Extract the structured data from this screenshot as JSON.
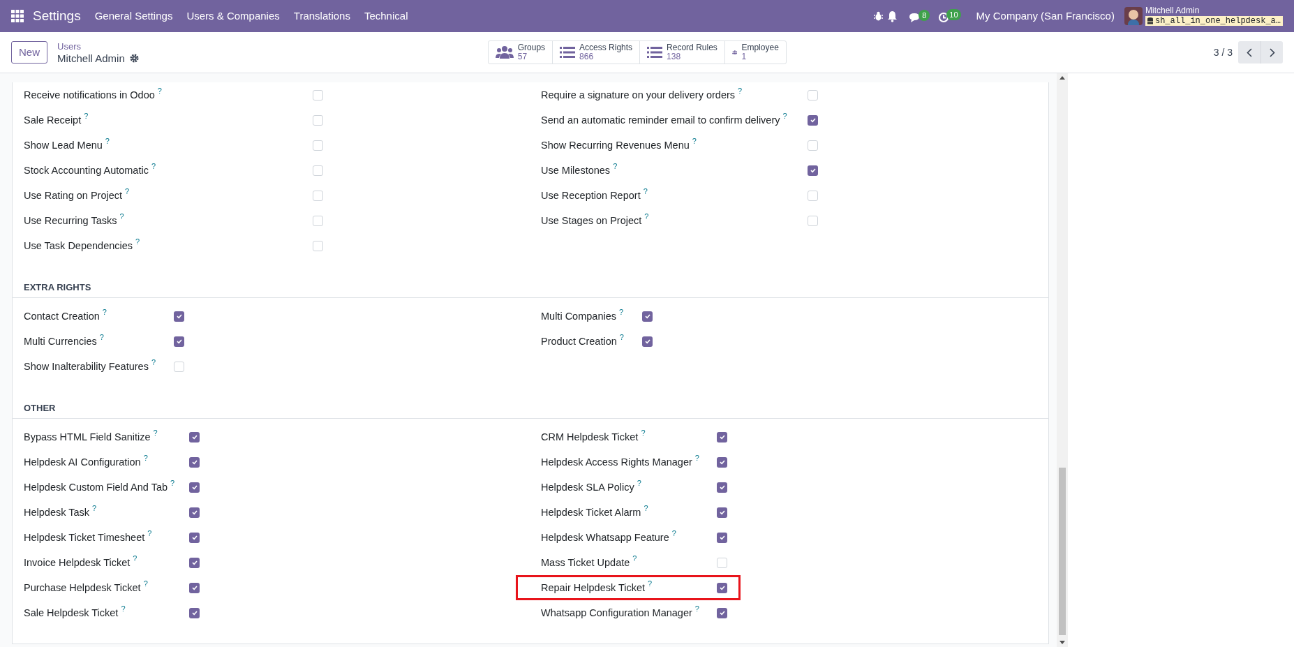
{
  "navbar": {
    "app_title": "Settings",
    "menu": [
      "General Settings",
      "Users & Companies",
      "Translations",
      "Technical"
    ],
    "chat_badge": "8",
    "activity_badge": "10",
    "company": "My Company (San Francisco)",
    "user_name": "Mitchell Admin",
    "database": "sh_all_in_one_helpdesk_a…"
  },
  "control_panel": {
    "new_button": "New",
    "breadcrumb": "Users",
    "record_name": "Mitchell Admin",
    "pager": "3 / 3",
    "smart_buttons": [
      {
        "kind": "users",
        "label": "Groups",
        "value": "57"
      },
      {
        "kind": "list",
        "label": "Access Rights",
        "value": "866"
      },
      {
        "kind": "list",
        "label": "Record Rules",
        "value": "138"
      },
      {
        "kind": "users",
        "label": "Employee",
        "value": "1"
      }
    ]
  },
  "sections": [
    {
      "left_items": [
        {
          "label": "Receive notifications in Odoo",
          "hint": "?",
          "checked": false
        },
        {
          "label": "Sale Receipt",
          "hint": "?",
          "checked": false
        },
        {
          "label": "Show Lead Menu",
          "hint": "?",
          "checked": false
        },
        {
          "label": "Stock Accounting Automatic",
          "hint": "?",
          "checked": false
        },
        {
          "label": "Use Rating on Project",
          "hint": "?",
          "checked": false
        },
        {
          "label": "Use Recurring Tasks",
          "hint": "?",
          "checked": false
        },
        {
          "label": "Use Task Dependencies",
          "hint": "?",
          "checked": false
        }
      ],
      "right_items": [
        {
          "label": "Require a signature on your delivery orders",
          "hint": "?",
          "checked": false
        },
        {
          "label": "Send an automatic reminder email to confirm delivery",
          "hint": "?",
          "checked": true
        },
        {
          "label": "Show Recurring Revenues Menu",
          "hint": "?",
          "checked": false
        },
        {
          "label": "Use Milestones",
          "hint": "?",
          "checked": true
        },
        {
          "label": "Use Reception Report",
          "hint": "?",
          "checked": false
        },
        {
          "label": "Use Stages on Project",
          "hint": "?",
          "checked": false
        }
      ]
    },
    {
      "title": "EXTRA RIGHTS",
      "left_items": [
        {
          "label": "Contact Creation",
          "hint": "?",
          "checked": true
        },
        {
          "label": "Multi Currencies",
          "hint": "?",
          "checked": true
        },
        {
          "label": "Show Inalterability Features",
          "hint": "?",
          "checked": false
        }
      ],
      "right_items": [
        {
          "label": "Multi Companies",
          "hint": "?",
          "checked": true
        },
        {
          "label": "Product Creation",
          "hint": "?",
          "checked": true
        }
      ]
    },
    {
      "title": "OTHER",
      "left_items": [
        {
          "label": "Bypass HTML Field Sanitize",
          "hint": "?",
          "checked": true
        },
        {
          "label": "Helpdesk AI Configuration",
          "hint": "?",
          "checked": true
        },
        {
          "label": "Helpdesk Custom Field And Tab",
          "hint": "?",
          "checked": true
        },
        {
          "label": "Helpdesk Task",
          "hint": "?",
          "checked": true
        },
        {
          "label": "Helpdesk Ticket Timesheet",
          "hint": "?",
          "checked": true
        },
        {
          "label": "Invoice Helpdesk Ticket",
          "hint": "?",
          "checked": true
        },
        {
          "label": "Purchase Helpdesk Ticket",
          "hint": "?",
          "checked": true
        },
        {
          "label": "Sale Helpdesk Ticket",
          "hint": "?",
          "checked": true
        }
      ],
      "right_items": [
        {
          "label": "CRM Helpdesk Ticket",
          "hint": "?",
          "checked": true
        },
        {
          "label": "Helpdesk Access Rights Manager",
          "hint": "?",
          "checked": true
        },
        {
          "label": "Helpdesk SLA Policy",
          "hint": "?",
          "checked": true
        },
        {
          "label": "Helpdesk Ticket Alarm",
          "hint": "?",
          "checked": true
        },
        {
          "label": "Helpdesk Whatsapp Feature",
          "hint": "?",
          "checked": true
        },
        {
          "label": "Mass Ticket Update",
          "hint": "?",
          "checked": false
        },
        {
          "label": "Repair Helpdesk Ticket",
          "hint": "?",
          "checked": true,
          "highlighted": true
        },
        {
          "label": "Whatsapp Configuration Manager",
          "hint": "?",
          "checked": true
        }
      ]
    }
  ]
}
